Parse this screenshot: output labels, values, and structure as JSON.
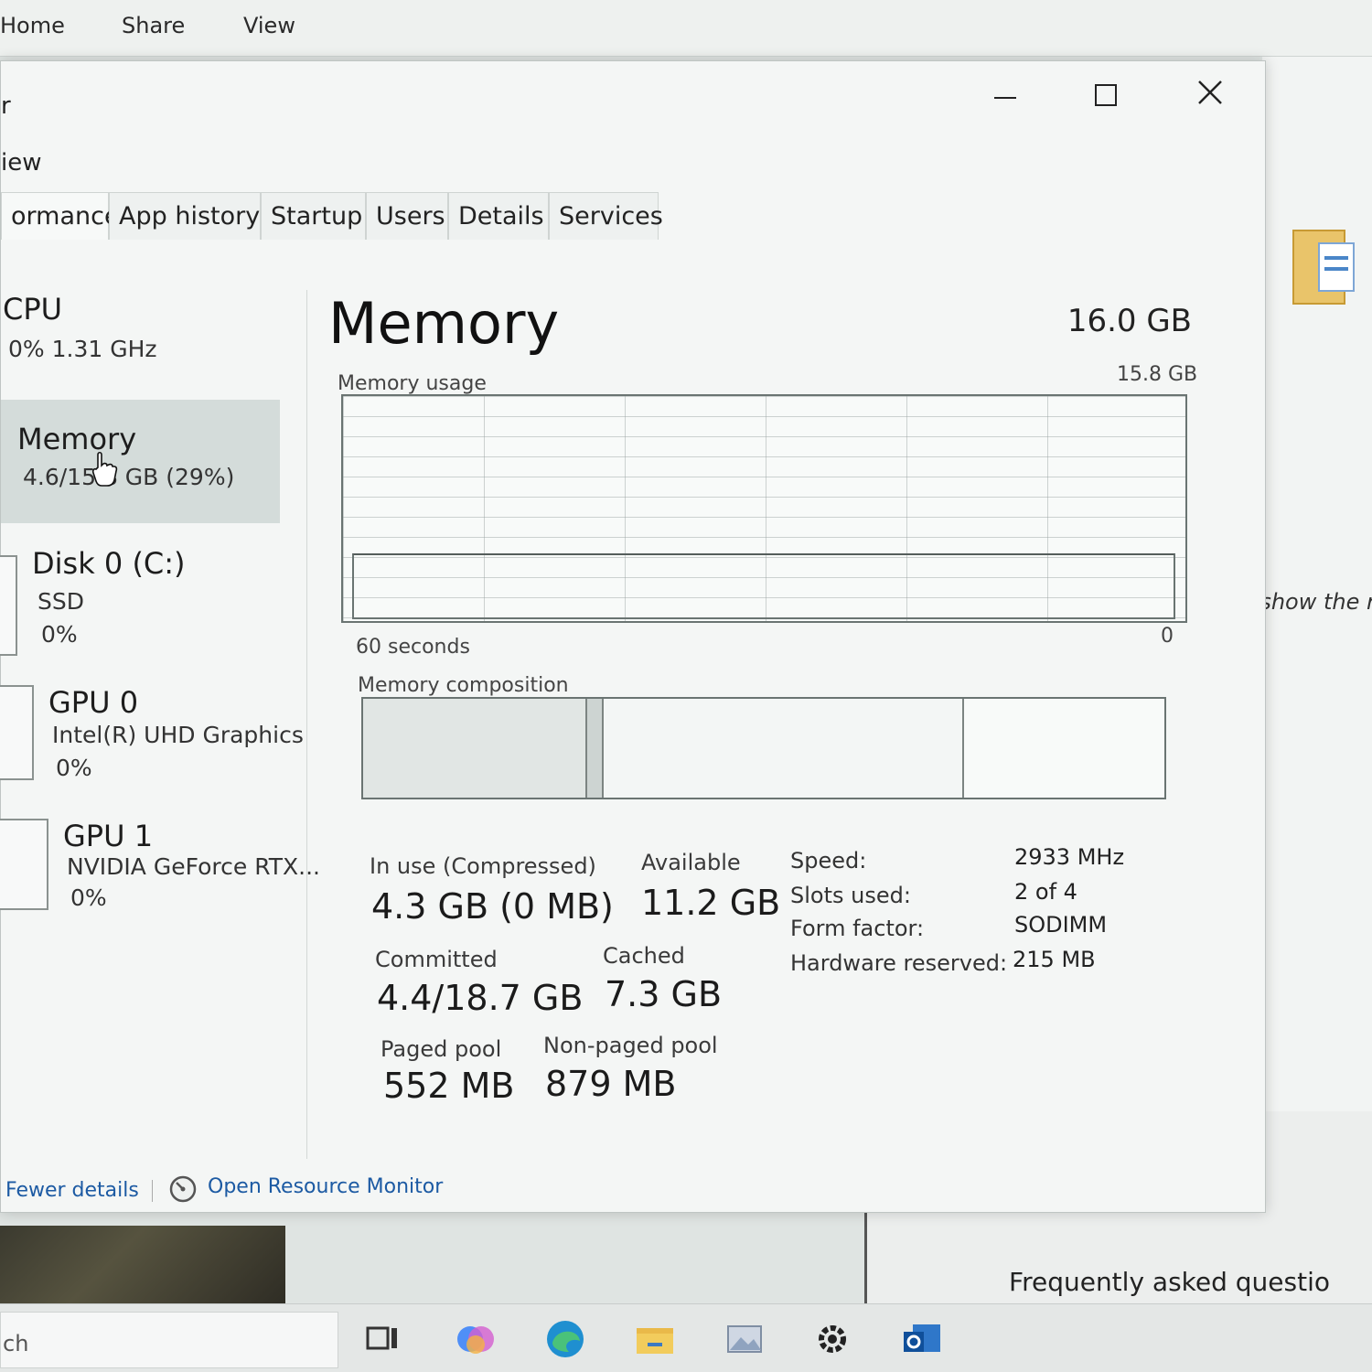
{
  "explorer": {
    "ribbon": [
      "Home",
      "Share",
      "View"
    ],
    "hint_text": "e'll show the r",
    "faq_text": "Frequently asked questio"
  },
  "taskbar": {
    "search_text": "ch"
  },
  "task_manager": {
    "menu_fragment_top": "r",
    "menu_fragment_view": "iew",
    "tabs": [
      "ormance",
      "App history",
      "Startup",
      "Users",
      "Details",
      "Services"
    ],
    "sidebar": {
      "cpu": {
        "title": "CPU",
        "sub": "0% 1.31 GHz"
      },
      "memory": {
        "title": "Memory",
        "sub": "4.6/15.8 GB (29%)"
      },
      "disk": {
        "title": "Disk 0 (C:)",
        "sub1": "SSD",
        "sub2": "0%"
      },
      "gpu0": {
        "title": "GPU 0",
        "sub1": "Intel(R) UHD Graphics",
        "sub2": "0%"
      },
      "gpu1": {
        "title": "GPU 1",
        "sub1": "NVIDIA GeForce RTX...",
        "sub2": "0%"
      }
    },
    "main": {
      "title": "Memory",
      "total": "16.0 GB",
      "usage_label": "Memory usage",
      "usage_max": "15.8 GB",
      "time_label": "60 seconds",
      "zero_label": "0",
      "composition_label": "Memory composition",
      "composition_segments": [
        0.28,
        0.02,
        0.45,
        0.25
      ],
      "stats": {
        "in_use_label": "In use (Compressed)",
        "in_use_value": "4.3 GB (0 MB)",
        "available_label": "Available",
        "available_value": "11.2 GB",
        "committed_label": "Committed",
        "committed_value": "4.4/18.7 GB",
        "cached_label": "Cached",
        "cached_value": "7.3 GB",
        "paged_label": "Paged pool",
        "paged_value": "552 MB",
        "nonpaged_label": "Non-paged pool",
        "nonpaged_value": "879 MB"
      },
      "specs": {
        "speed_label": "Speed:",
        "speed_value": "2933 MHz",
        "slots_label": "Slots used:",
        "slots_value": "2 of 4",
        "form_label": "Form factor:",
        "form_value": "SODIMM",
        "hw_label": "Hardware reserved:",
        "hw_value": "215 MB"
      }
    },
    "footer": {
      "fewer_details": "Fewer details",
      "open_resource_monitor": "Open Resource Monitor"
    }
  }
}
